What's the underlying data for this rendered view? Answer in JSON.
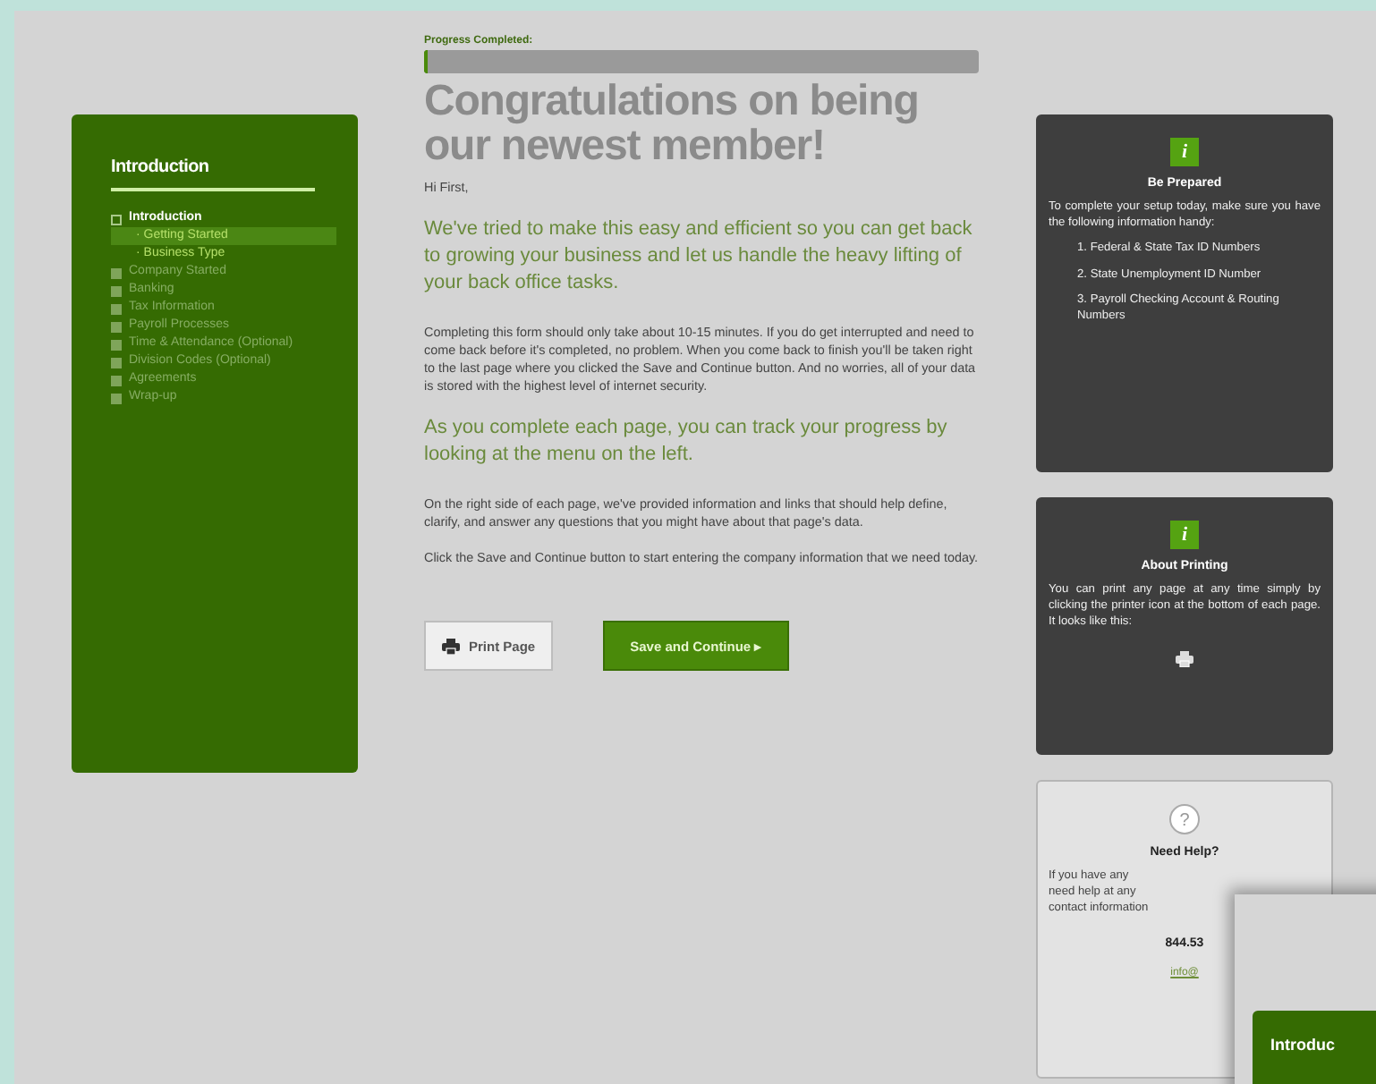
{
  "progress": {
    "label": "Progress Completed:",
    "level": 0
  },
  "sidebar": {
    "title": "Introduction",
    "items": [
      {
        "label": "Introduction",
        "expanded": true,
        "children": [
          {
            "bullet": "·",
            "label": "Getting Started",
            "selected": true
          },
          {
            "bullet": "·",
            "label": "Business Type",
            "selected": false
          }
        ]
      },
      {
        "label": "Company Started",
        "expanded": false
      },
      {
        "label": "Banking",
        "expanded": false
      },
      {
        "label": "Tax Information",
        "expanded": false
      },
      {
        "label": "Payroll Processes",
        "expanded": false
      },
      {
        "label": "Time & Attendance (Optional)",
        "expanded": false
      },
      {
        "label": "Division Codes (Optional)",
        "expanded": false
      },
      {
        "label": "Agreements",
        "expanded": false
      },
      {
        "label": "Wrap-up",
        "expanded": false
      }
    ]
  },
  "main": {
    "heading": "Congratulations on being our newest member!",
    "paragraphs": [
      {
        "kind": "small",
        "text": "Hi First,"
      },
      {
        "kind": "lead",
        "text": "We've tried to make this easy and efficient so you can get back to growing your business and let us handle the heavy lifting of your back office tasks."
      },
      {
        "kind": "small",
        "text": "Completing this form should only take about 10-15 minutes. If you do get interrupted and need to come back before it's completed, no problem. When you come back to finish you'll be taken right to the last page where you clicked the Save and Continue button. And no worries, all of your data is stored with the highest level of internet security."
      },
      {
        "kind": "lead",
        "text": "As you complete each page, you can track your progress by looking at the menu on the left."
      },
      {
        "kind": "small",
        "text": "On the right side of each page, we've provided information and links that should help define, clarify, and answer any questions that you might have about that page's data."
      },
      {
        "kind": "small",
        "text": "Click the Save and Continue button to start entering the company information that we need today."
      }
    ],
    "print_button": "Print Page",
    "save_button": "Save and Continue ▸"
  },
  "cards": [
    {
      "kind": "info",
      "icon_text": "i",
      "title": "Be Prepared",
      "text": "To complete your setup today, make sure you have the following information handy:",
      "list": [
        "1. Federal & State Tax ID Numbers",
        "2. State Unemployment ID Number",
        "3. Payroll Checking Account & Routing Numbers"
      ]
    },
    {
      "kind": "printing",
      "icon_text": "i",
      "title": "About Printing",
      "text": "You can print any page at any time simply by clicking the printer icon at the bottom of each page. It looks like this:"
    },
    {
      "kind": "help",
      "icon_text": "?",
      "title": "Need Help?",
      "lines": [
        "If you have any",
        "need help at any",
        "contact information"
      ],
      "phone": "844.53",
      "email": "info@"
    }
  ],
  "overlay": {
    "title": "Introduc"
  }
}
